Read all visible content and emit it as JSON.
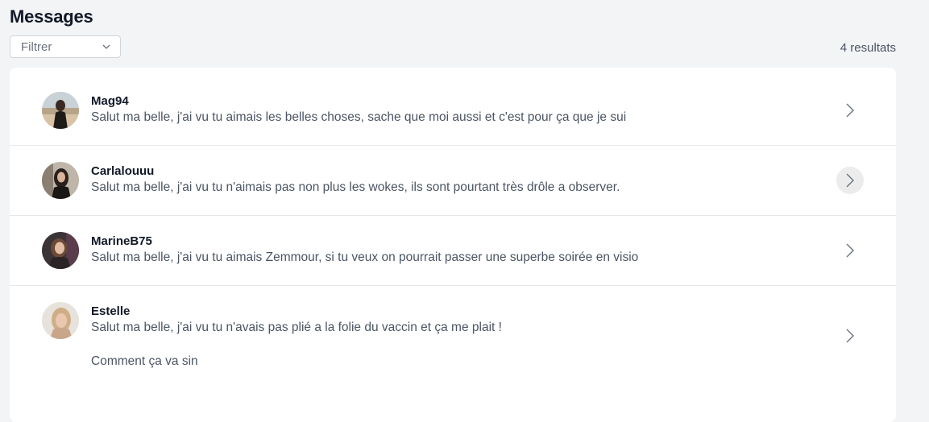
{
  "page": {
    "title": "Messages"
  },
  "filter": {
    "label": "Filtrer",
    "icon": "chevron-down-icon"
  },
  "results": {
    "count_label": "4 resultats"
  },
  "conversations": [
    {
      "name": "Mag94",
      "message": "Salut ma belle, j'ai vu tu aimais les belles choses, sache que moi aussi et c'est pour ça que je sui",
      "message_extra": ""
    },
    {
      "name": "Carlalouuu",
      "message": "Salut ma belle, j'ai vu tu n'aimais pas non plus les wokes, ils sont pourtant très drôle a observer.",
      "message_extra": ""
    },
    {
      "name": "MarineB75",
      "message": "Salut ma belle, j'ai vu tu aimais Zemmour, si tu veux on pourrait passer une superbe soirée en visio",
      "message_extra": ""
    },
    {
      "name": "Estelle",
      "message": "Salut ma belle, j'ai vu tu n'avais pas plié a la folie du vaccin et ça me plait !",
      "message_extra": "Comment ça va sin"
    }
  ],
  "colors": {
    "background": "#f3f4f6",
    "card": "#ffffff",
    "divider": "#e5e7eb",
    "hover_chevron_bg": "#ececec"
  }
}
